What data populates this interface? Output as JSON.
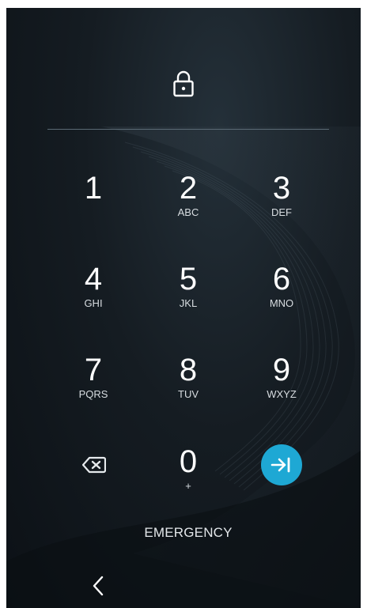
{
  "lockscreen": {
    "icons": {
      "lock": "lock-icon",
      "backspace": "backspace-icon",
      "enter": "enter-arrow-icon",
      "back": "back-chevron-icon"
    },
    "accent_color": "#1ea8d4",
    "keypad": [
      {
        "digit": "1",
        "letters": ""
      },
      {
        "digit": "2",
        "letters": "ABC"
      },
      {
        "digit": "3",
        "letters": "DEF"
      },
      {
        "digit": "4",
        "letters": "GHI"
      },
      {
        "digit": "5",
        "letters": "JKL"
      },
      {
        "digit": "6",
        "letters": "MNO"
      },
      {
        "digit": "7",
        "letters": "PQRS"
      },
      {
        "digit": "8",
        "letters": "TUV"
      },
      {
        "digit": "9",
        "letters": "WXYZ"
      },
      {
        "digit": "0",
        "letters": "+"
      }
    ],
    "emergency_label": "EMERGENCY"
  }
}
